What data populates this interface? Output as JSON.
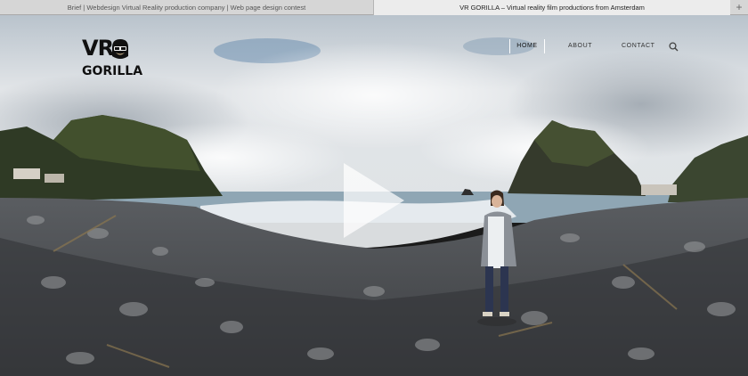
{
  "browser": {
    "tabs": [
      {
        "label": "Brief | Webdesign Virtual Reality production company | Web page design contest",
        "active": false
      },
      {
        "label": "VR GORILLA – Virtual reality film productions from Amsterdam",
        "active": true
      }
    ],
    "new_tab_icon": "plus-icon"
  },
  "logo": {
    "line1": "VR",
    "line2": "GORILLA",
    "icon": "gorilla-head-icon"
  },
  "nav": {
    "items": [
      {
        "label": "HOME",
        "active": true
      },
      {
        "label": "ABOUT",
        "active": false
      },
      {
        "label": "CONTACT",
        "active": false
      }
    ],
    "search_icon": "magnifier-icon"
  },
  "hero": {
    "play_icon": "play-triangle-icon"
  },
  "colors": {
    "sky": "#cfd5dc",
    "sea": "#8fa6b4",
    "stones": "#6b6d70",
    "text": "#333333"
  }
}
